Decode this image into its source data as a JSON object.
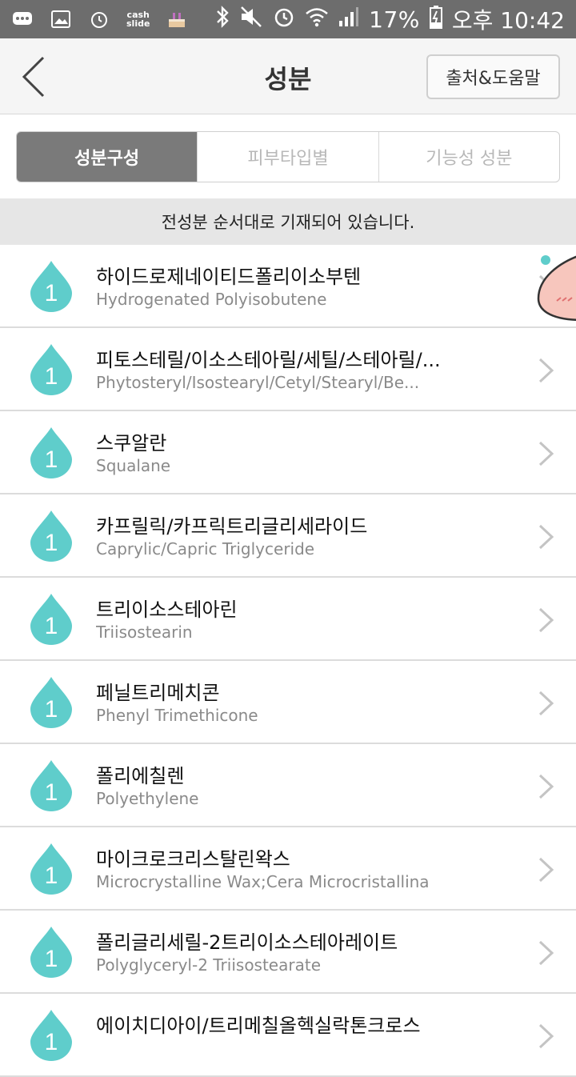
{
  "status_bar": {
    "cash_slide": "cash\nslide",
    "battery": "17%",
    "time": "오후 10:42"
  },
  "header": {
    "title": "성분",
    "help_button": "출처&도움말"
  },
  "tabs": [
    {
      "label": "성분구성",
      "active": true
    },
    {
      "label": "피부타입별",
      "active": false
    },
    {
      "label": "기능성 성분",
      "active": false
    }
  ],
  "notice": "전성분 순서대로 기재되어 있습니다.",
  "ingredients": [
    {
      "grade": "1",
      "name_ko": "하이드로제네이티드폴리이소부텐",
      "name_en": "Hydrogenated Polyisobutene"
    },
    {
      "grade": "1",
      "name_ko": "피토스테릴/이소스테아릴/세틸/스테아릴/...",
      "name_en": "Phytosteryl/Isostearyl/Cetyl/Stearyl/Be..."
    },
    {
      "grade": "1",
      "name_ko": "스쿠알란",
      "name_en": "Squalane"
    },
    {
      "grade": "1",
      "name_ko": "카프릴릭/카프릭트리글리세라이드",
      "name_en": "Caprylic/Capric Triglyceride"
    },
    {
      "grade": "1",
      "name_ko": "트리이소스테아린",
      "name_en": "Triisostearin"
    },
    {
      "grade": "1",
      "name_ko": "페닐트리메치콘",
      "name_en": "Phenyl Trimethicone"
    },
    {
      "grade": "1",
      "name_ko": "폴리에칠렌",
      "name_en": "Polyethylene"
    },
    {
      "grade": "1",
      "name_ko": "마이크로크리스탈린왁스",
      "name_en": "Microcrystalline Wax;Cera Microcristallina"
    },
    {
      "grade": "1",
      "name_ko": "폴리글리세릴-2트리이소스테아레이트",
      "name_en": "Polyglyceryl-2 Triisostearate"
    },
    {
      "grade": "1",
      "name_ko": "에이치디아이/트리메칠올헥실락톤크로스",
      "name_en": ""
    }
  ],
  "colors": {
    "drop": "#5fcdcb",
    "tab_active": "#7a7a7a",
    "status_bar": "#6d6d6d"
  }
}
